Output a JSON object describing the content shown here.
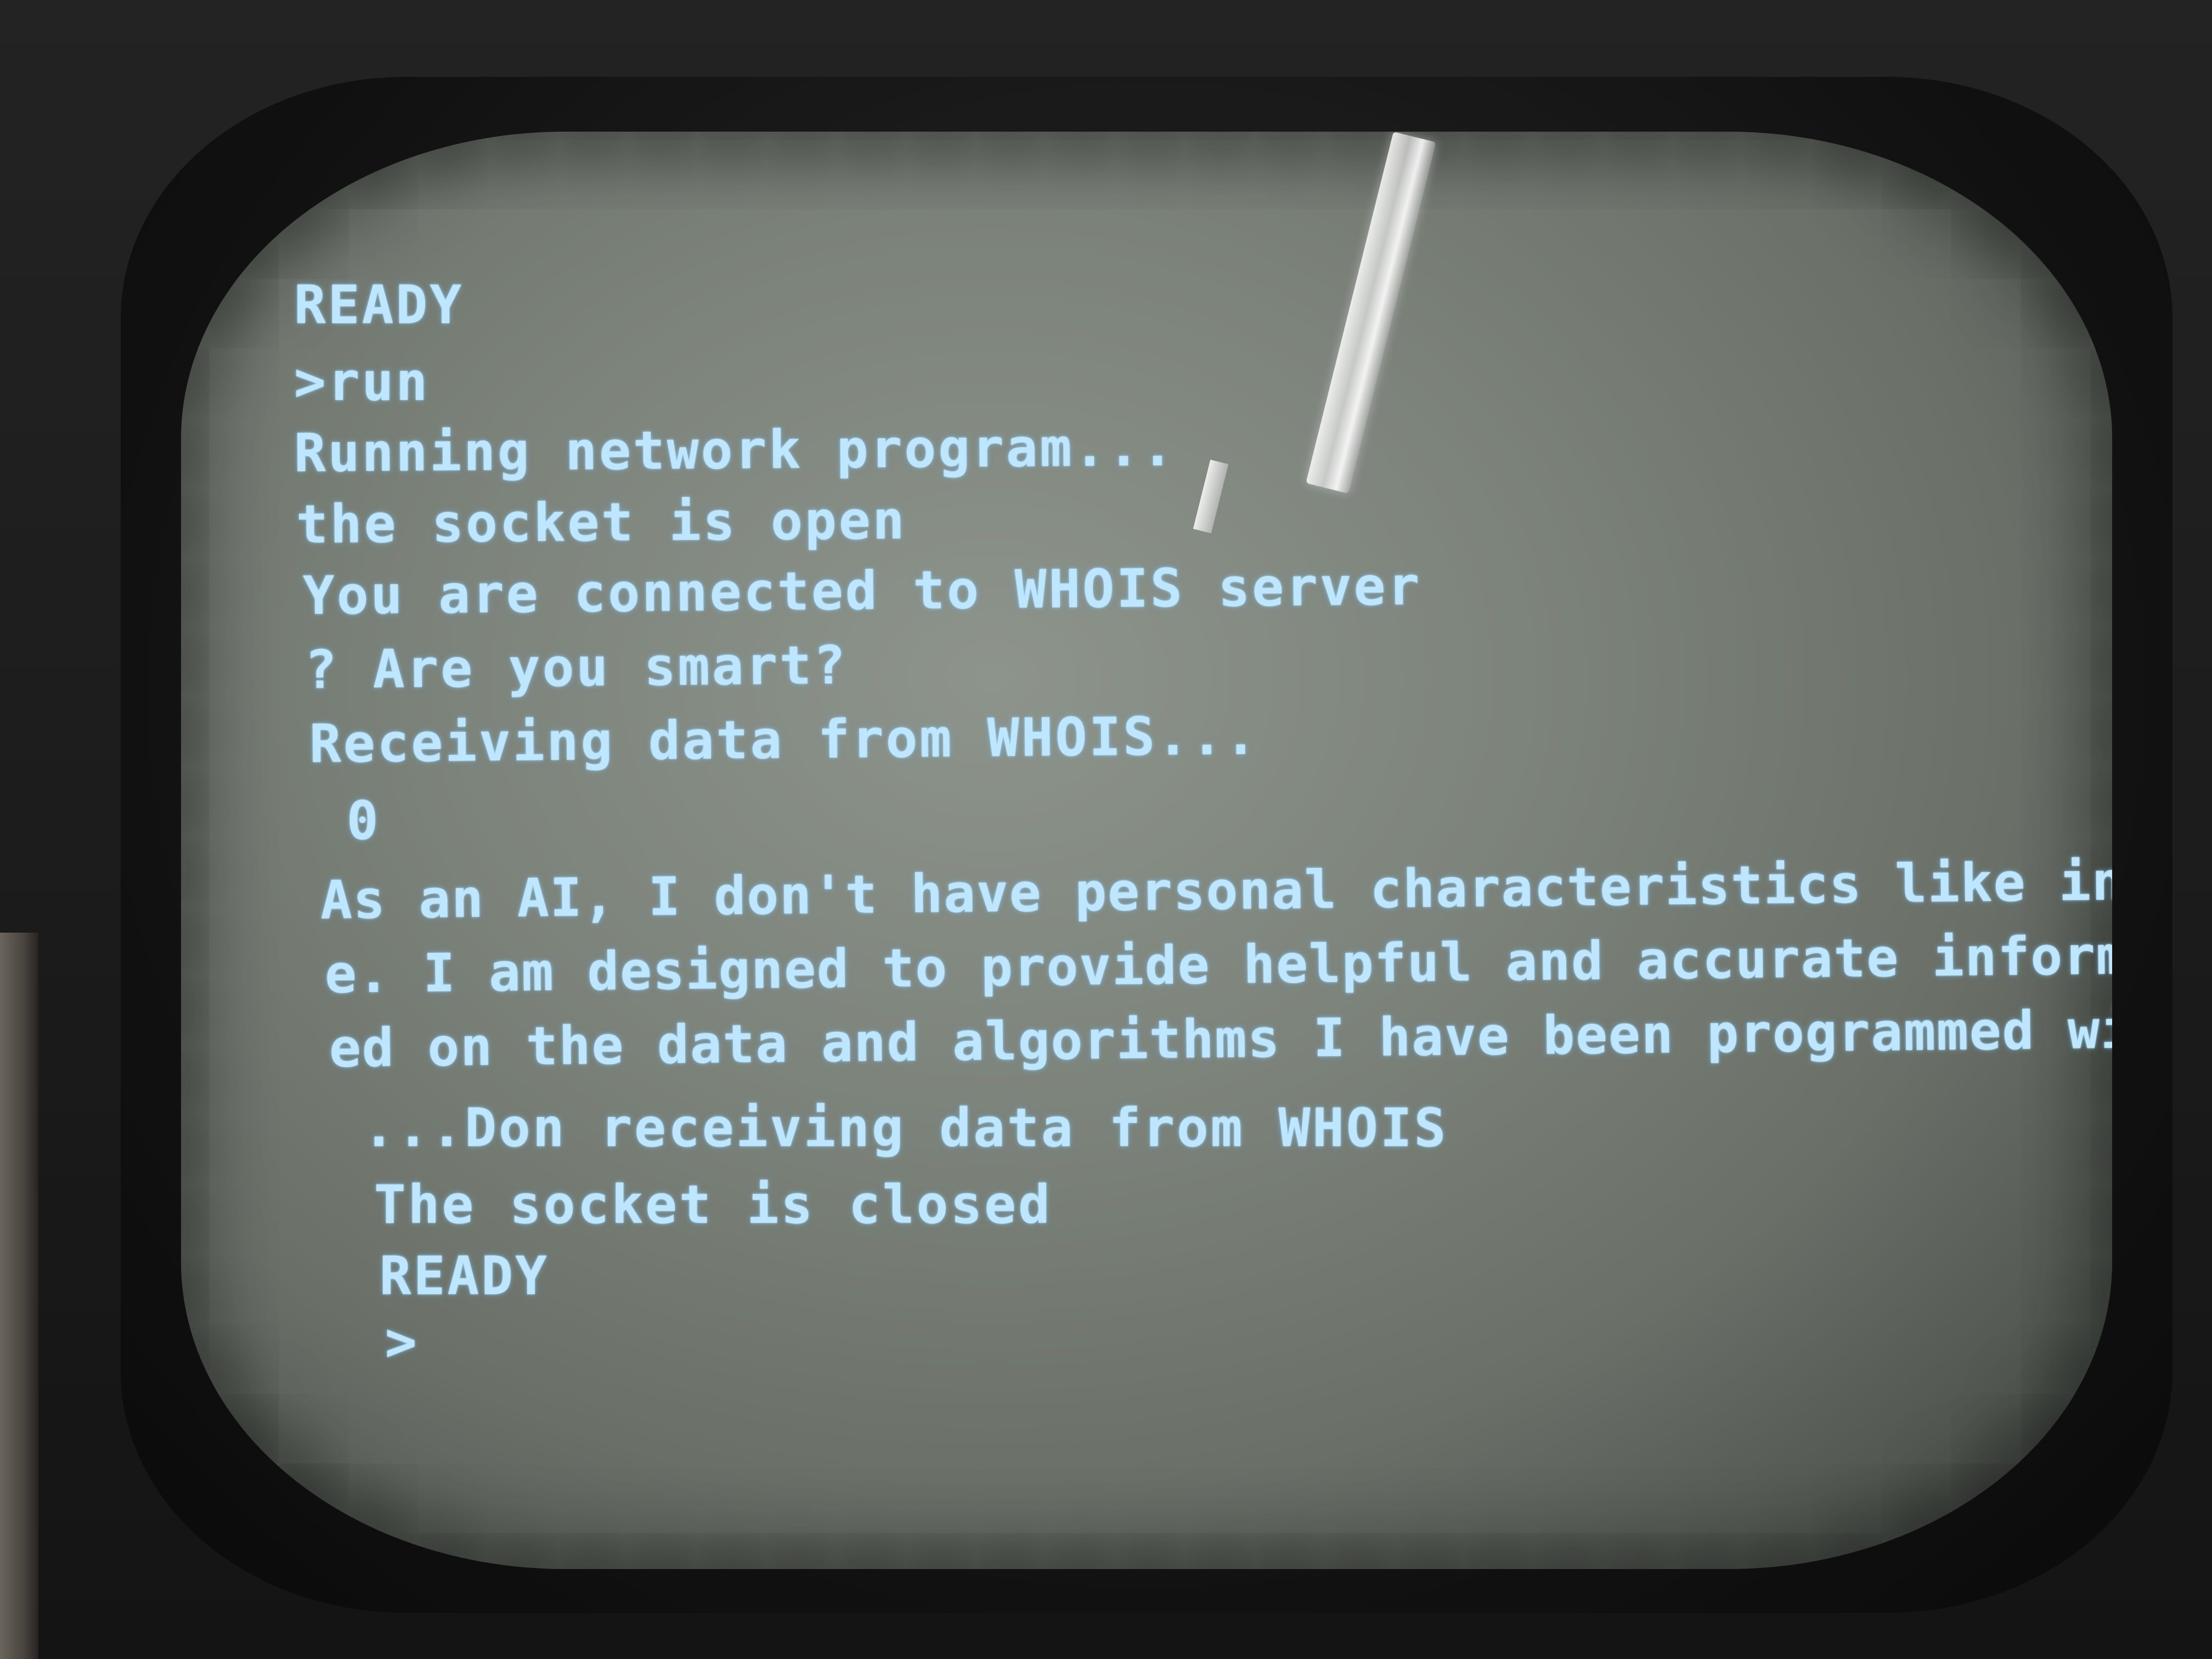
{
  "terminal": {
    "lines": [
      "READY",
      ">run",
      "Running network program...",
      "the socket is open",
      "You are connected to WHOIS server",
      "? Are you smart?",
      "Receiving data from WHOIS...",
      " 0",
      "As an AI, I don't have personal characteristics like intelligenc",
      "e. I am designed to provide helpful and accurate information bas",
      "ed on the data and algorithms I have been programmed with.",
      " ...Don receiving data from WHOIS",
      " The socket is closed",
      " READY",
      " >"
    ]
  },
  "colors": {
    "phosphor_text": "#bfe6ff",
    "screen_glass": "#7c837b",
    "bezel": "#111111"
  }
}
